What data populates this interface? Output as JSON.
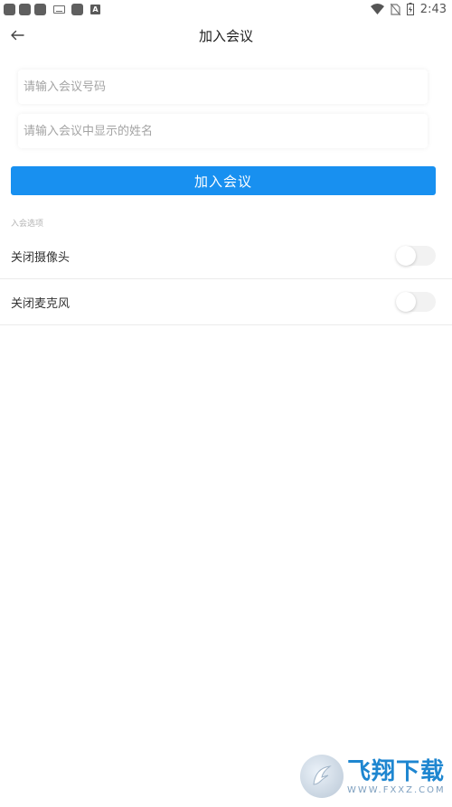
{
  "status_bar": {
    "time": "2:43",
    "icons": [
      "app-icon",
      "app-icon",
      "app-icon",
      "keyboard-icon",
      "app-icon",
      "a-icon",
      "wifi-icon",
      "no-sim-icon",
      "battery-charging-icon"
    ],
    "a_badge": "A"
  },
  "header": {
    "back_icon": "arrow-left-icon",
    "title": "加入会议"
  },
  "form": {
    "meeting_number_placeholder": "请输入会议号码",
    "meeting_number_value": "",
    "display_name_placeholder": "请输入会议中显示的姓名",
    "display_name_value": ""
  },
  "join_button": {
    "label": "加入会议",
    "color": "#1890f0"
  },
  "options": {
    "section_title": "入会选项",
    "items": [
      {
        "label": "关闭摄像头",
        "enabled": false
      },
      {
        "label": "关闭麦克风",
        "enabled": false
      }
    ]
  },
  "watermark": {
    "main_text": "飞翔下载",
    "sub_text": "WWW.FXXZ.COM"
  }
}
